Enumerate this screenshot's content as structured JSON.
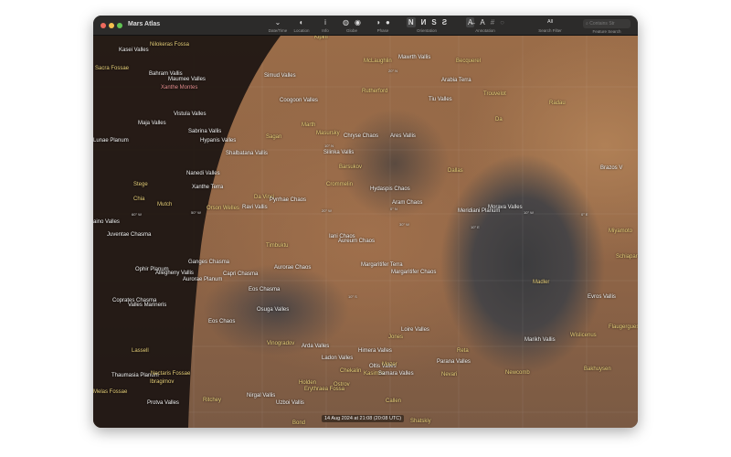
{
  "window": {
    "title": "Mars Atlas",
    "traffic_colors": [
      "#ed6a5e",
      "#f5bf4f",
      "#61c554"
    ]
  },
  "toolbar": {
    "date_time": {
      "label": "Date/Time",
      "icon": "sundial-icon"
    },
    "location": {
      "label": "Location",
      "icon": "location-globe-icon"
    },
    "info": {
      "label": "Info",
      "icon": "info-icon",
      "glyph": "i"
    },
    "globe": {
      "label": "Globe",
      "icons": [
        "globe-small-icon",
        "globe-large-icon"
      ]
    },
    "phase": {
      "label": "Phase",
      "icons": [
        "half-phase-icon",
        "full-phase-icon"
      ]
    },
    "orientation": {
      "label": "Orientation",
      "options": [
        "N",
        "И",
        "S",
        "Ƨ"
      ],
      "selected": "N"
    },
    "annotation": {
      "label": "Annotation",
      "options": [
        "A̶",
        "A",
        "#",
        "○"
      ]
    },
    "search_filter": {
      "label": "Search Filter",
      "value": "All"
    },
    "feature_search": {
      "label": "Feature Search",
      "placeholder": "Contains Str"
    }
  },
  "map": {
    "date": "14 Aug 2024 at 21:08 (20:08 UTC)",
    "labels": [
      {
        "t": "Kasei Valles",
        "c": "w"
      },
      {
        "t": "Nilokeras Fossa",
        "c": "y"
      },
      {
        "t": "Sacra Fossae",
        "c": "y"
      },
      {
        "t": "Bahram Vallis",
        "c": "w"
      },
      {
        "t": "Maumee Valles",
        "c": "w"
      },
      {
        "t": "Xanthe Montes",
        "c": "r"
      },
      {
        "t": "Vistula Valles",
        "c": "w"
      },
      {
        "t": "Maja Valles",
        "c": "w"
      },
      {
        "t": "Sabrina Vallis",
        "c": "w"
      },
      {
        "t": "Lunae Planum",
        "c": "w"
      },
      {
        "t": "Hypanis Valles",
        "c": "w"
      },
      {
        "t": "Shalbatana Vallis",
        "c": "w"
      },
      {
        "t": "Nanedi Valles",
        "c": "w"
      },
      {
        "t": "Stege",
        "c": "y"
      },
      {
        "t": "Xanthe Terra",
        "c": "w"
      },
      {
        "t": "Chia",
        "c": "y"
      },
      {
        "t": "Mutch",
        "c": "y"
      },
      {
        "t": "60° W",
        "c": "g"
      },
      {
        "t": "50° W",
        "c": "g"
      },
      {
        "t": "Orson Welles",
        "c": "y"
      },
      {
        "t": "Ravi Vallis",
        "c": "w"
      },
      {
        "t": "Da Vinci",
        "c": "y"
      },
      {
        "t": "Pyrrhae Chaos",
        "c": "w"
      },
      {
        "t": "aino Valles",
        "c": "w"
      },
      {
        "t": "Juventae Chasma",
        "c": "w"
      },
      {
        "t": "Timbuktu",
        "c": "y"
      },
      {
        "t": "Ganges Chasma",
        "c": "w"
      },
      {
        "t": "Ophir Planum",
        "c": "w"
      },
      {
        "t": "Allegheny Vallis",
        "c": "w"
      },
      {
        "t": "Capri Chasma",
        "c": "w"
      },
      {
        "t": "Aurorae Planum",
        "c": "w"
      },
      {
        "t": "Aurorae Chaos",
        "c": "w"
      },
      {
        "t": "Eos Chasma",
        "c": "w"
      },
      {
        "t": "Coprates Chasma",
        "c": "w"
      },
      {
        "t": "Valles Marineris",
        "c": "w"
      },
      {
        "t": "Osuga Valles",
        "c": "w"
      },
      {
        "t": "Eos Chaos",
        "c": "w"
      },
      {
        "t": "Lassell",
        "c": "y"
      },
      {
        "t": "Vinogradov",
        "c": "y"
      },
      {
        "t": "Arda Valles",
        "c": "w"
      },
      {
        "t": "Ladon Valles",
        "c": "w"
      },
      {
        "t": "Himera Valles",
        "c": "w"
      },
      {
        "t": "Loire Valles",
        "c": "w"
      },
      {
        "t": "Jones",
        "c": "y"
      },
      {
        "t": "Thaumasia Planum",
        "c": "w"
      },
      {
        "t": "Nectaris Fossae",
        "c": "y"
      },
      {
        "t": "Ibragimov",
        "c": "y"
      },
      {
        "t": "Melas Fossae",
        "c": "y"
      },
      {
        "t": "Protva Valles",
        "c": "w"
      },
      {
        "t": "Ritchey",
        "c": "y"
      },
      {
        "t": "Nirgal Vallis",
        "c": "w"
      },
      {
        "t": "Uzboi Vallis",
        "c": "w"
      },
      {
        "t": "Holden",
        "c": "y"
      },
      {
        "t": "Erythraea Fossa",
        "c": "y"
      },
      {
        "t": "Ostrov",
        "c": "y"
      },
      {
        "t": "Chekalin",
        "c": "y"
      },
      {
        "t": "Oltis Valles",
        "c": "w"
      },
      {
        "t": "Mozer",
        "c": "y"
      },
      {
        "t": "Kasimov",
        "c": "y"
      },
      {
        "t": "Samara Valles",
        "c": "w"
      },
      {
        "t": "Parana Valles",
        "c": "w"
      },
      {
        "t": "Reta",
        "c": "y"
      },
      {
        "t": "Nevari",
        "c": "y"
      },
      {
        "t": "Newcomb",
        "c": "y"
      },
      {
        "t": "Marikh Vallis",
        "c": "w"
      },
      {
        "t": "Wislicenus",
        "c": "y"
      },
      {
        "t": "Flaugergues",
        "c": "y"
      },
      {
        "t": "Bakhuysen",
        "c": "y"
      },
      {
        "t": "Evros Vallis",
        "c": "w"
      },
      {
        "t": "Madler",
        "c": "y"
      },
      {
        "t": "Bond",
        "c": "y"
      },
      {
        "t": "Shatskiy",
        "c": "y"
      },
      {
        "t": "Kipini",
        "c": "y"
      },
      {
        "t": "McLaughlin",
        "c": "y"
      },
      {
        "t": "Mawrth Vallis",
        "c": "w"
      },
      {
        "t": "20° N",
        "c": "g"
      },
      {
        "t": "Simud Valles",
        "c": "w"
      },
      {
        "t": "Becquerel",
        "c": "y"
      },
      {
        "t": "Arabia Terra",
        "c": "w"
      },
      {
        "t": "Rutherford",
        "c": "y"
      },
      {
        "t": "Coogoon Valles",
        "c": "w"
      },
      {
        "t": "Tiu Valles",
        "c": "w"
      },
      {
        "t": "Trouvelot",
        "c": "y"
      },
      {
        "t": "Radau",
        "c": "y"
      },
      {
        "t": "Da",
        "c": "y"
      },
      {
        "t": "Marth",
        "c": "y"
      },
      {
        "t": "Masursky",
        "c": "y"
      },
      {
        "t": "Sagan",
        "c": "y"
      },
      {
        "t": "Chryse Chaos",
        "c": "w"
      },
      {
        "t": "Ares Vallis",
        "c": "w"
      },
      {
        "t": "10° N",
        "c": "g"
      },
      {
        "t": "Silinka Vallis",
        "c": "w"
      },
      {
        "t": "Barsukov",
        "c": "y"
      },
      {
        "t": "Dallas",
        "c": "y"
      },
      {
        "t": "Crommelin",
        "c": "y"
      },
      {
        "t": "Hydaspis Chaos",
        "c": "w"
      },
      {
        "t": "Aram Chaos",
        "c": "w"
      },
      {
        "t": "0° N",
        "c": "g"
      },
      {
        "t": "20° W",
        "c": "g"
      },
      {
        "t": "30° W",
        "c": "g"
      },
      {
        "t": "Iani Chaos",
        "c": "w"
      },
      {
        "t": "Aureum Chaos",
        "c": "w"
      },
      {
        "t": "Margaritifer Terra",
        "c": "w"
      },
      {
        "t": "Margaritifer Chaos",
        "c": "w"
      },
      {
        "t": "10° S",
        "c": "g"
      },
      {
        "t": "Morava Valles",
        "c": "w"
      },
      {
        "t": "Meridiani Planum",
        "c": "w"
      },
      {
        "t": "10° W",
        "c": "g"
      },
      {
        "t": "0° E",
        "c": "g"
      },
      {
        "t": "10° E",
        "c": "g"
      },
      {
        "t": "Miyamoto",
        "c": "y"
      },
      {
        "t": "Schiaparelli",
        "c": "y"
      },
      {
        "t": "Brazos V",
        "c": "w"
      },
      {
        "t": "Callen",
        "c": "y"
      },
      {
        "t": "30° S",
        "c": "g"
      }
    ]
  }
}
